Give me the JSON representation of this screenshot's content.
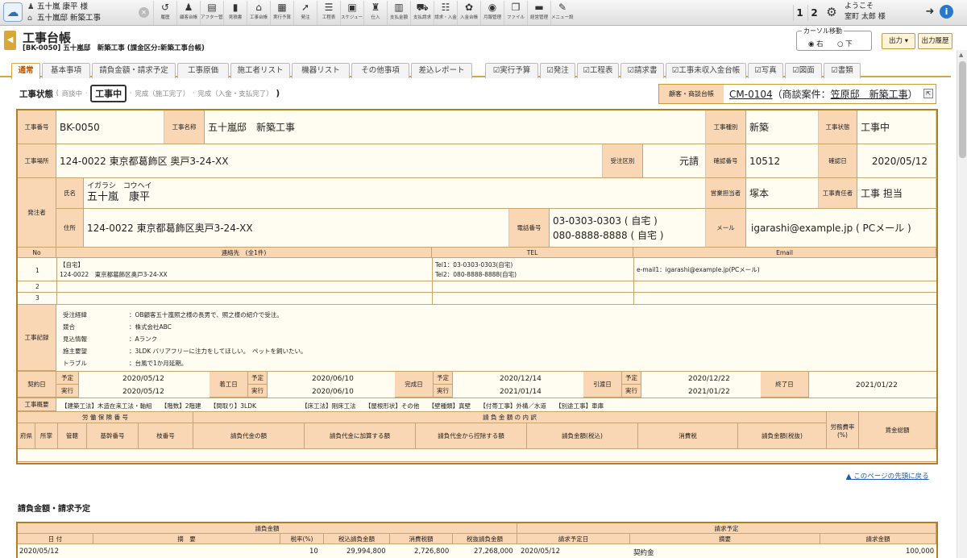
{
  "header": {
    "customer_name": "五十嵐 康平 様",
    "project_name": "五十嵐邸 新築工事",
    "welcome": "ようこそ",
    "user_name": "室町 太郎 様",
    "num1": "1",
    "num2": "2"
  },
  "toolbar": [
    {
      "icon": "↺",
      "label": "履歴"
    },
    {
      "icon": "♟",
      "label": "顧客台帳"
    },
    {
      "icon": "▤",
      "label": "アフター管理"
    },
    {
      "icon": "▮",
      "label": "見積書"
    },
    {
      "icon": "⌂",
      "label": "工事台帳"
    },
    {
      "icon": "▦",
      "label": "実行予算"
    },
    {
      "icon": "➚",
      "label": "発注"
    },
    {
      "icon": "☰",
      "label": "工程表"
    },
    {
      "icon": "▣",
      "label": "スケジュール"
    },
    {
      "icon": "♜",
      "label": "仕入"
    },
    {
      "icon": "▥",
      "label": "支払金額"
    },
    {
      "icon": "⛟",
      "label": "支払請求"
    },
    {
      "icon": "☷",
      "label": "請求・入金"
    },
    {
      "icon": "✿",
      "label": "入金台帳"
    },
    {
      "icon": "◉",
      "label": "月報管理"
    },
    {
      "icon": "❐",
      "label": "ファイル"
    },
    {
      "icon": "▬",
      "label": "経営管理"
    },
    {
      "icon": "✎",
      "label": "メニュー設定"
    }
  ],
  "page": {
    "title": "工事台帳",
    "subtitle": "[BK-0050] 五十嵐邸　新築工事 (課金区分:新築工事台帳)",
    "cursor_label": "カーソル移動",
    "cursor_right": "右",
    "cursor_down": "下",
    "output_btn": "出力 ▾",
    "history_btn": "出力履歴"
  },
  "tabs": [
    "通常",
    "基本事項",
    "請負金額・請求予定",
    "工事原価",
    "施工者リスト",
    "機器リスト",
    "その他事項",
    "差込レポート",
    "☑実行予算",
    "☑発注",
    "☑工程表",
    "☑請求書",
    "☑工事未収入金台帳",
    "☑写真",
    "☑図面",
    "☑書類"
  ],
  "status": {
    "label": "工事状態",
    "s1": "商談中",
    "s2": "工事中",
    "s3": "完成（施工完了）",
    "s4": "完成（入金・支払完了）",
    "close": ")",
    "open": "("
  },
  "cm": {
    "label": "顧客・商談台帳",
    "code": "CM-0104",
    "text1": "（商談案件：",
    "link": "笠原邸　新築工事",
    "text2": "）"
  },
  "project": {
    "no_label": "工事番号",
    "no": "BK-0050",
    "name_label": "工事名称",
    "name": "五十嵐邸　新築工事",
    "type_label": "工事種別",
    "type": "新築",
    "state_label": "工事状態",
    "state": "工事中",
    "place_label": "工事場所",
    "place": "124-0022 東京都葛飾区 奥戸3-24-XX",
    "order_label": "受注区別",
    "order": "元請",
    "conf_label": "確認番号",
    "conf": "10512",
    "confdate_label": "確認日",
    "confdate": "2020/05/12"
  },
  "orderer": {
    "label": "発注者",
    "name_label": "氏名",
    "kana": "イガラシ　コウヘイ",
    "name": "五十嵐　康平",
    "addr_label": "住所",
    "addr": "124-0022 東京都葛飾区奥戸3-24-XX",
    "tel_label": "電話番号",
    "tel1": "03-0303-0303 ( 自宅 )",
    "tel2": "080-8888-8888 ( 自宅 )",
    "sales_label": "営業担当者",
    "sales": "塚本",
    "resp_label": "工事責任者",
    "resp": "工事 担当",
    "mail_label": "メール",
    "mail": "igarashi@example.jp ( PCメール )"
  },
  "contacts": {
    "h_no": "No",
    "h_contact": "連絡先　(全1件)",
    "h_tel": "TEL",
    "h_email": "Email",
    "rows": [
      {
        "no": "1",
        "c1": "【自宅】",
        "c2": "124-0022　東京都葛飾区奥戸3-24-XX",
        "t1": "Tel1：03-0303-0303(自宅)",
        "t2": "Tel2：080-8888-8888(自宅)",
        "e": "e-mail1：igarashi@example.jp(PCメール)"
      },
      {
        "no": "2"
      },
      {
        "no": "3"
      }
    ]
  },
  "record": {
    "label": "工事記録",
    "items": [
      {
        "k": "受注経緯",
        "v": "：OB顧客五十嵐照之様の長男で、照之様の紹介で受注。"
      },
      {
        "k": "競合",
        "v": "：株式会社ABC"
      },
      {
        "k": "見込情報",
        "v": "：Aランク"
      },
      {
        "k": "施主要望",
        "v": "：3LDK バリアフリーに注力をしてほしい。　ペットを飼いたい。"
      },
      {
        "k": "トラブル",
        "v": "：台風で1か月延期。"
      }
    ]
  },
  "dates": {
    "contract": "契約日",
    "start": "着工日",
    "complete": "完成日",
    "delivery": "引渡日",
    "end": "終了日",
    "plan": "予定",
    "actual": "実行",
    "c_p": "2020/05/12",
    "c_a": "2020/05/12",
    "s_p": "2020/06/10",
    "s_a": "2020/06/10",
    "cm_p": "2020/12/14",
    "cm_a": "2021/01/14",
    "d_p": "2020/12/22",
    "d_a": "2021/01/22",
    "end_v": "2021/01/22"
  },
  "summary": {
    "label": "工事概要",
    "text": "【建築工法】木造在来工法・軸組　　【階数】2階建　　【間取り】3LDK　　　　　　　　【床工法】剛床工法　　【屋根形状】その他　　【壁種類】真壁　　【付帯工事】外構／水道　　【別途工事】車庫"
  },
  "insurance": {
    "h1": "労 働 保 険 番 号",
    "h2": "請 負 金 額 の 内 訳",
    "h3": "労務費率(%)",
    "h4": "賃金総額",
    "c1": "府県",
    "c2": "所掌",
    "c3": "管轄",
    "c4": "基幹番号",
    "c5": "枝番号",
    "c6": "請負代金の額",
    "c7": "請負代金に加算する額",
    "c8": "請負代金から控除する額",
    "c9": "請負金額(税込)",
    "c10": "消費税",
    "c11": "請負金額(税抜)"
  },
  "pagetop": "▲ このページの先頭に戻る",
  "billing": {
    "title": "請負金額・請求予定",
    "h_amount": "請負金額",
    "h_plan": "請求予定",
    "c_date": "日 付",
    "c_desc": "摘　要",
    "c_rate": "税率(%)",
    "c_incl": "税込請負金額",
    "c_tax": "消費税額",
    "c_excl": "税抜請負金額",
    "c_pdate": "請求予定日",
    "c_pdesc": "摘要",
    "c_pamt": "請求金額",
    "r_date": "2020/05/12",
    "r_rate": "10",
    "r_incl": "29,994,800",
    "r_tax": "2,726,800",
    "r_excl": "27,268,000",
    "r_pdate": "2020/05/12",
    "r_pdesc": "契約金",
    "r_pamt": "100,000"
  }
}
